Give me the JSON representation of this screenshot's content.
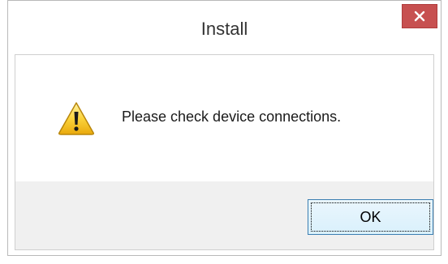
{
  "window": {
    "title": "Install",
    "close_icon": "close-icon",
    "close_color": "#c75050"
  },
  "message": {
    "icon": "warning-icon",
    "text": "Please check device connections."
  },
  "buttons": {
    "ok_label": "OK"
  }
}
